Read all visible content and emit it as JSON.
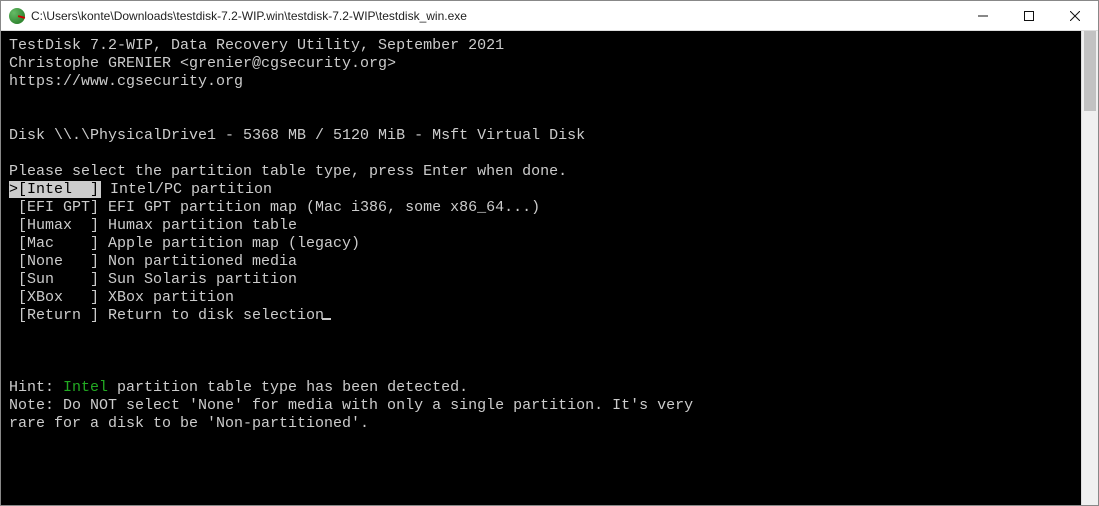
{
  "titlebar": {
    "path": "C:\\Users\\konte\\Downloads\\testdisk-7.2-WIP.win\\testdisk-7.2-WIP\\testdisk_win.exe"
  },
  "header": {
    "line1": "TestDisk 7.2-WIP, Data Recovery Utility, September 2021",
    "line2": "Christophe GRENIER <grenier@cgsecurity.org>",
    "line3": "https://www.cgsecurity.org"
  },
  "disk_line": "Disk \\\\.\\PhysicalDrive1 - 5368 MB / 5120 MiB - Msft Virtual Disk",
  "prompt": "Please select the partition table type, press Enter when done.",
  "options": [
    {
      "bracket": ">[Intel  ]",
      "desc": " Intel/PC partition",
      "selected": true
    },
    {
      "bracket": " [EFI GPT]",
      "desc": " EFI GPT partition map (Mac i386, some x86_64...)"
    },
    {
      "bracket": " [Humax  ]",
      "desc": " Humax partition table"
    },
    {
      "bracket": " [Mac    ]",
      "desc": " Apple partition map (legacy)"
    },
    {
      "bracket": " [None   ]",
      "desc": " Non partitioned media"
    },
    {
      "bracket": " [Sun    ]",
      "desc": " Sun Solaris partition"
    },
    {
      "bracket": " [XBox   ]",
      "desc": " XBox partition"
    },
    {
      "bracket": " [Return ]",
      "desc": " Return to disk selection"
    }
  ],
  "hint": {
    "prefix": "Hint: ",
    "detected": "Intel",
    "suffix": " partition table type has been detected."
  },
  "note1": "Note: Do NOT select 'None' for media with only a single partition. It's very",
  "note2": "rare for a disk to be 'Non-partitioned'."
}
